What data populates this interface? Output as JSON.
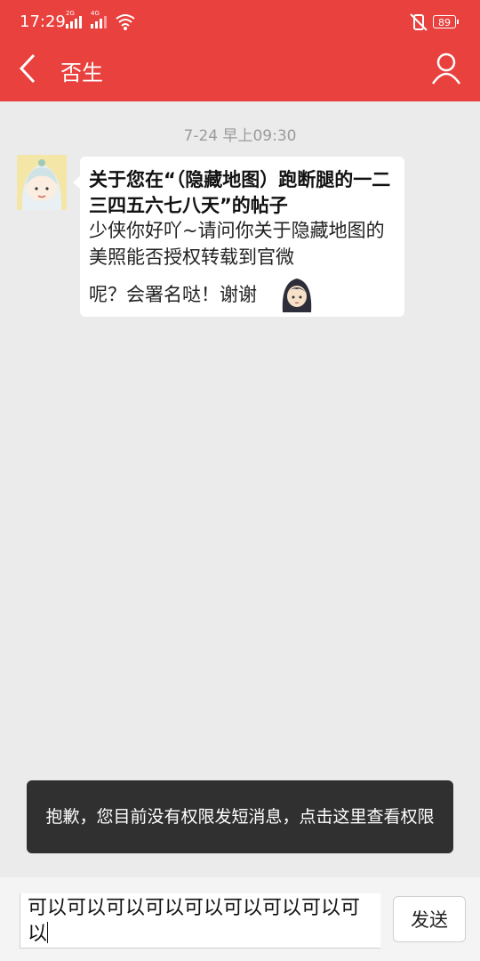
{
  "status_bar": {
    "time": "17:29",
    "sim1_label": "2G",
    "sim2_label": "4G",
    "battery": "89"
  },
  "header": {
    "title": "否生",
    "back_icon": "chevron-left-icon",
    "profile_icon": "user-icon"
  },
  "conversation": {
    "timestamp": "7-24 早上09:30",
    "message": {
      "title": "关于您在“（隐藏地图）跑断腿的一二三四五六七八天”的帖子",
      "body": "少侠你好吖~请问你关于隐藏地图的美照能否授权转载到官微",
      "tail": "呢？会署名哒！谢谢"
    }
  },
  "toast": {
    "text": "抱歉，您目前没有权限发短消息，点击这里查看权限"
  },
  "composer": {
    "input_value": "可以可以可以可以可以可以可以可以可以",
    "send_label": "发送"
  },
  "colors": {
    "header_red": "#e8413e",
    "background": "#ebebeb",
    "toast_bg": "#303030"
  }
}
